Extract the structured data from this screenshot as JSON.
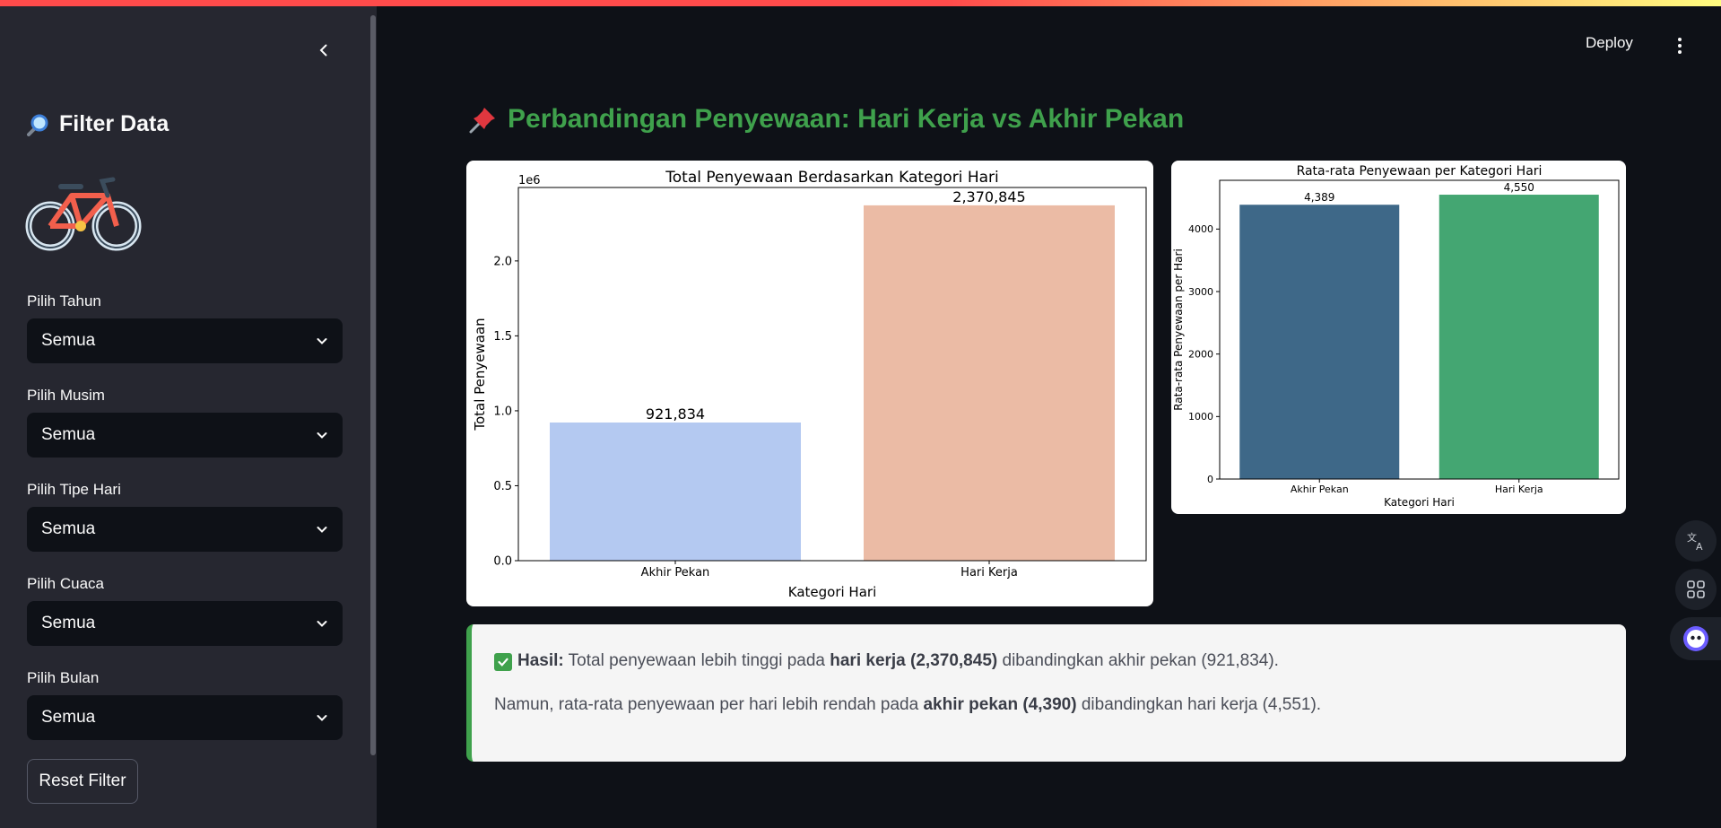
{
  "sidebar": {
    "title": "Filter Data",
    "filters": [
      {
        "label": "Pilih Tahun",
        "value": "Semua"
      },
      {
        "label": "Pilih Musim",
        "value": "Semua"
      },
      {
        "label": "Pilih Tipe Hari",
        "value": "Semua"
      },
      {
        "label": "Pilih Cuaca",
        "value": "Semua"
      },
      {
        "label": "Pilih Bulan",
        "value": "Semua"
      }
    ],
    "reset_label": "Reset Filter"
  },
  "header": {
    "deploy_label": "Deploy"
  },
  "main": {
    "title": "Perbandingan Penyewaan: Hari Kerja vs Akhir Pekan",
    "result": {
      "label": "Hasil:",
      "line1_a": " Total penyewaan lebih tinggi pada ",
      "line1_b": "hari kerja (2,370,845)",
      "line1_c": " dibandingkan akhir pekan (921,834).",
      "line2_a": "Namun, rata-rata penyewaan per hari lebih rendah pada ",
      "line2_b": "akhir pekan (4,390)",
      "line2_c": " dibandingkan hari kerja (4,551)."
    }
  },
  "colors": {
    "accent_green": "#3fa14c",
    "bar_weekend": "#b4c9f1",
    "bar_weekday": "#ebbba5",
    "bar_avg_weekend": "#3e6888",
    "bar_avg_weekday": "#44a672"
  },
  "chart_data": [
    {
      "type": "bar",
      "title": "Total Penyewaan Berdasarkan Kategori Hari",
      "xlabel": "Kategori Hari",
      "ylabel": "Total Penyewaan",
      "scale_label": "1e6",
      "categories": [
        "Akhir Pekan",
        "Hari Kerja"
      ],
      "values": [
        921834,
        2370845
      ],
      "data_labels": [
        "921,834",
        "2,370,845"
      ],
      "ylim": [
        0,
        2490000
      ],
      "yticks": [
        0,
        500000,
        1000000,
        1500000,
        2000000
      ],
      "ytick_labels": [
        "0.0",
        "0.5",
        "1.0",
        "1.5",
        "2.0"
      ],
      "colors": [
        "#b4c9f1",
        "#ebbba5"
      ]
    },
    {
      "type": "bar",
      "title": "Rata-rata Penyewaan per Kategori Hari",
      "xlabel": "Kategori Hari",
      "ylabel": "Rata-rata Penyewaan per Hari",
      "categories": [
        "Akhir Pekan",
        "Hari Kerja"
      ],
      "values": [
        4389,
        4550
      ],
      "data_labels": [
        "4,389",
        "4,550"
      ],
      "ylim": [
        0,
        4780
      ],
      "yticks": [
        0,
        1000,
        2000,
        3000,
        4000
      ],
      "ytick_labels": [
        "0",
        "1000",
        "2000",
        "3000",
        "4000"
      ],
      "colors": [
        "#3e6888",
        "#44a672"
      ]
    }
  ]
}
